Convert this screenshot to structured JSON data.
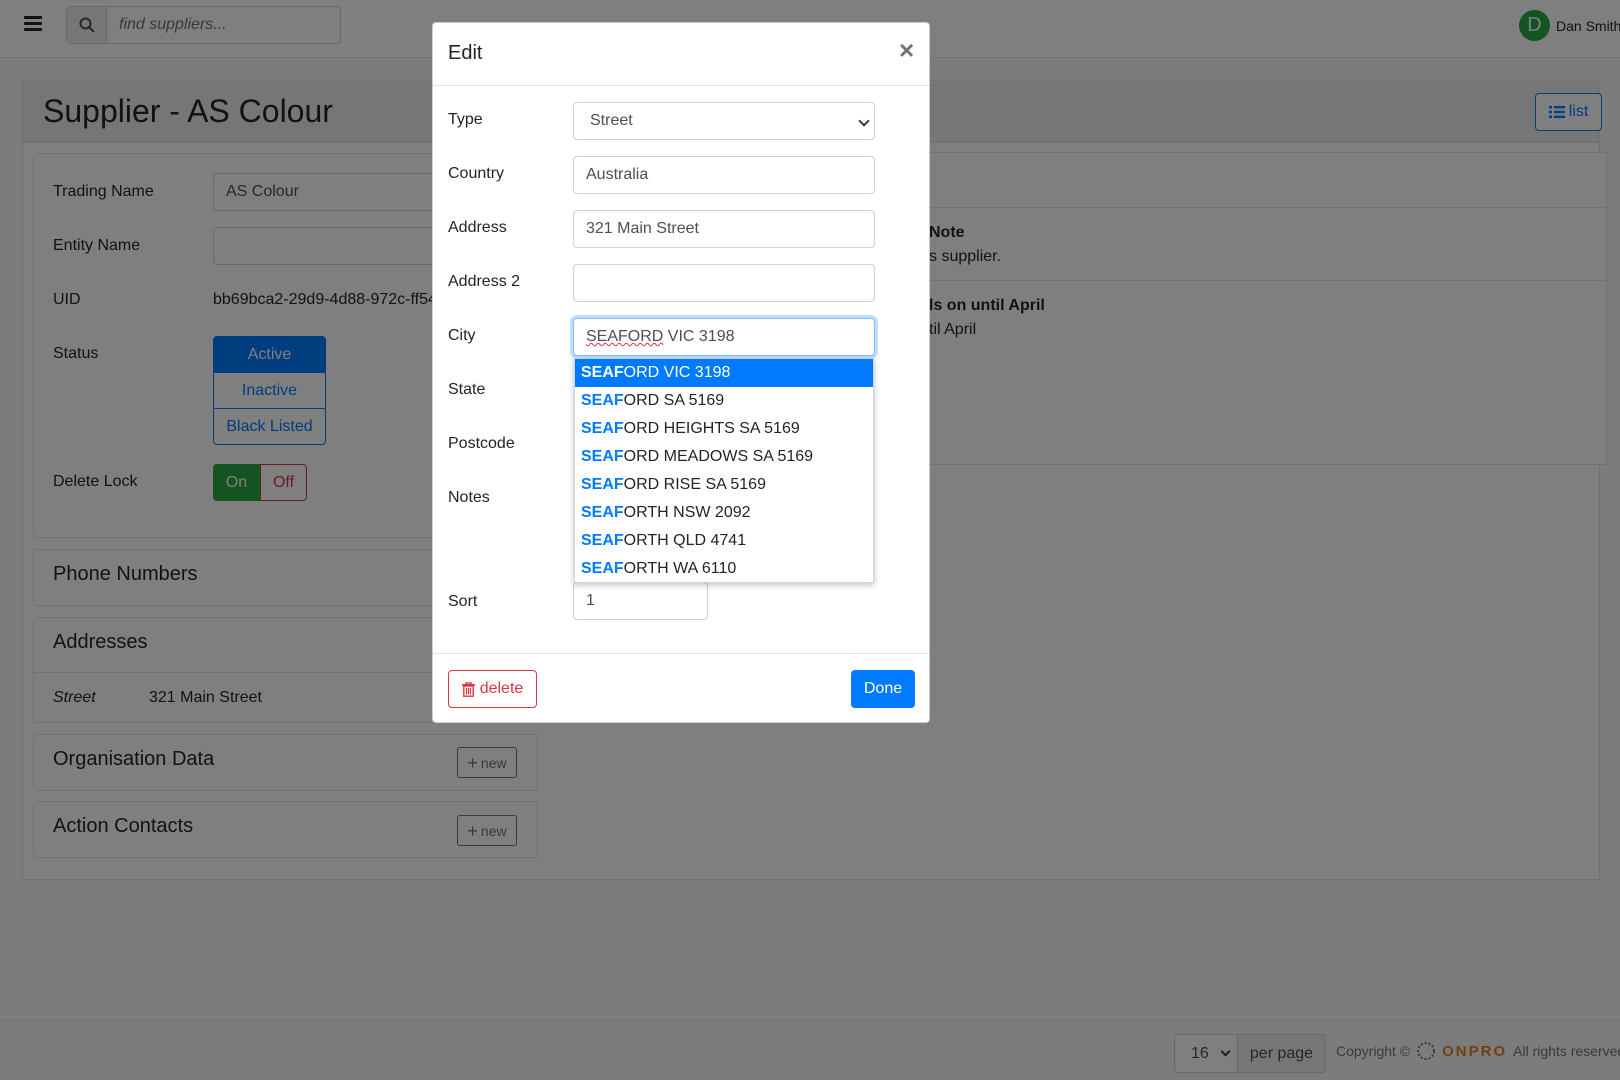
{
  "header": {
    "search_placeholder": "find suppliers...",
    "avatar_letter": "D",
    "user_name": "Dan Smith"
  },
  "page": {
    "title": "Supplier - AS Colour",
    "list_label": "list"
  },
  "details": {
    "trading_name_label": "Trading Name",
    "trading_name_value": "AS Colour",
    "entity_name_label": "Entity Name",
    "entity_name_value": "",
    "uid_label": "UID",
    "uid_value": "bb69bca2-29d9-4d88-972c-ff54",
    "status_label": "Status",
    "status_options": [
      "Active",
      "Inactive",
      "Black Listed"
    ],
    "status_selected": "Active",
    "delete_lock_label": "Delete Lock",
    "delete_lock_on": "On",
    "delete_lock_off": "Off"
  },
  "sections": {
    "phone_numbers": "Phone Numbers",
    "addresses": "Addresses",
    "address_row_type": "Street",
    "address_row_value": "321 Main Street",
    "organisation_data": "Organisation Data",
    "action_contacts": "Action Contacts",
    "new_label": "new"
  },
  "notes_panel": {
    "item1_title": "Note",
    "item1_text": "s supplier.",
    "item2_title": "ls on until April",
    "item2_text": "til April"
  },
  "modal": {
    "title": "Edit",
    "close": "×",
    "type_label": "Type",
    "type_value": "Street",
    "country_label": "Country",
    "country_value": "Australia",
    "address_label": "Address",
    "address_value": "321 Main Street",
    "address2_label": "Address 2",
    "address2_value": "",
    "city_label": "City",
    "city_value_word": "SEAFORD",
    "city_value_rest": " VIC 3198",
    "state_label": "State",
    "postcode_label": "Postcode",
    "notes_label": "Notes",
    "sort_label": "Sort",
    "sort_value": "1",
    "delete_label": "delete",
    "done_label": "Done",
    "suggestions": [
      {
        "match": "SEAF",
        "rest": "ORD VIC 3198"
      },
      {
        "match": "SEAF",
        "rest": "ORD SA 5169"
      },
      {
        "match": "SEAF",
        "rest": "ORD HEIGHTS SA 5169"
      },
      {
        "match": "SEAF",
        "rest": "ORD MEADOWS SA 5169"
      },
      {
        "match": "SEAF",
        "rest": "ORD RISE SA 5169"
      },
      {
        "match": "SEAF",
        "rest": "ORTH NSW 2092"
      },
      {
        "match": "SEAF",
        "rest": "ORTH QLD 4741"
      },
      {
        "match": "SEAF",
        "rest": "ORTH WA 6110"
      }
    ]
  },
  "footer": {
    "per_page_value": "16",
    "per_page_label": "per page",
    "copyright": "Copyright ©",
    "brand": "ONPRO",
    "rights": "All rights reserved"
  }
}
